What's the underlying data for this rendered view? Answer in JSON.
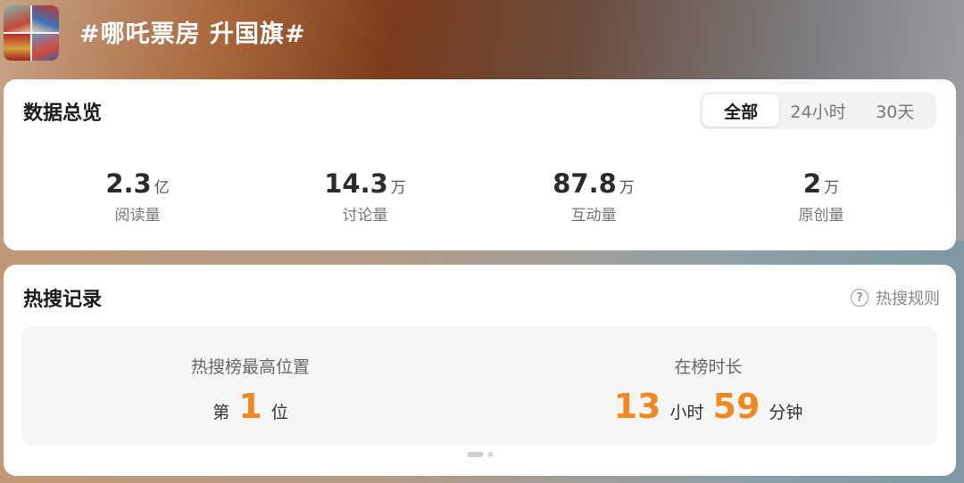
{
  "header": {
    "topic_title": "#哪吒票房 升国旗#"
  },
  "overview": {
    "title": "数据总览",
    "filters": [
      "全部",
      "24小时",
      "30天"
    ],
    "active_filter": "全部",
    "stats": [
      {
        "value": "2.3",
        "unit": "亿",
        "label": "阅读量"
      },
      {
        "value": "14.3",
        "unit": "万",
        "label": "讨论量"
      },
      {
        "value": "87.8",
        "unit": "万",
        "label": "互动量"
      },
      {
        "value": "2",
        "unit": "万",
        "label": "原创量"
      }
    ]
  },
  "hot_search": {
    "title": "热搜记录",
    "rules_label": "热搜规则",
    "rules_icon": "question-circle-icon",
    "highest_position": {
      "label": "热搜榜最高位置",
      "prefix": "第",
      "value": "1",
      "suffix": "位"
    },
    "duration": {
      "label": "在榜时长",
      "hours": "13",
      "hours_unit": "小时",
      "minutes": "59",
      "minutes_unit": "分钟"
    }
  },
  "colors": {
    "accent_orange": "#f0891f",
    "card_bg": "#ffffff",
    "panel_bg": "#f6f6f6"
  }
}
